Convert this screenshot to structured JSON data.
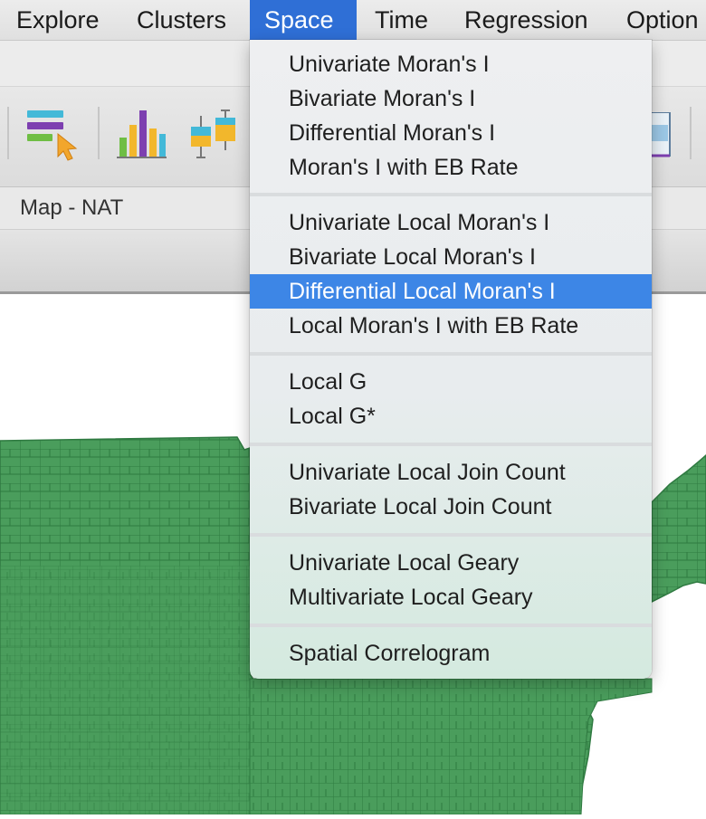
{
  "menubar": {
    "items": [
      {
        "label": "Explore"
      },
      {
        "label": "Clusters"
      },
      {
        "label": "Space",
        "active": true
      },
      {
        "label": "Time"
      },
      {
        "label": "Regression"
      },
      {
        "label": "Option"
      }
    ]
  },
  "toolbar": {
    "icons": [
      "table-select-icon",
      "histogram-icon",
      "box-plot-icon",
      "map-window-icon"
    ]
  },
  "window": {
    "tab_title": "Map - NAT"
  },
  "space_menu": {
    "groups": [
      [
        "Univariate Moran's I",
        "Bivariate Moran's I",
        "Differential Moran's I",
        "Moran's I with EB Rate"
      ],
      [
        "Univariate Local Moran's I",
        "Bivariate Local Moran's I",
        "Differential Local Moran's I",
        "Local Moran's I with EB Rate"
      ],
      [
        "Local G",
        "Local G*"
      ],
      [
        "Univariate Local Join Count",
        "Bivariate Local Join Count"
      ],
      [
        "Univariate Local Geary",
        "Multivariate Local Geary"
      ],
      [
        "Spatial Correlogram"
      ]
    ],
    "highlighted": "Differential Local Moran's I"
  },
  "colors": {
    "menu_active": "#2f6fd6",
    "item_highlight": "#3d86e6",
    "map_fill": "#4a9d5c",
    "map_border": "#2f7a41"
  }
}
